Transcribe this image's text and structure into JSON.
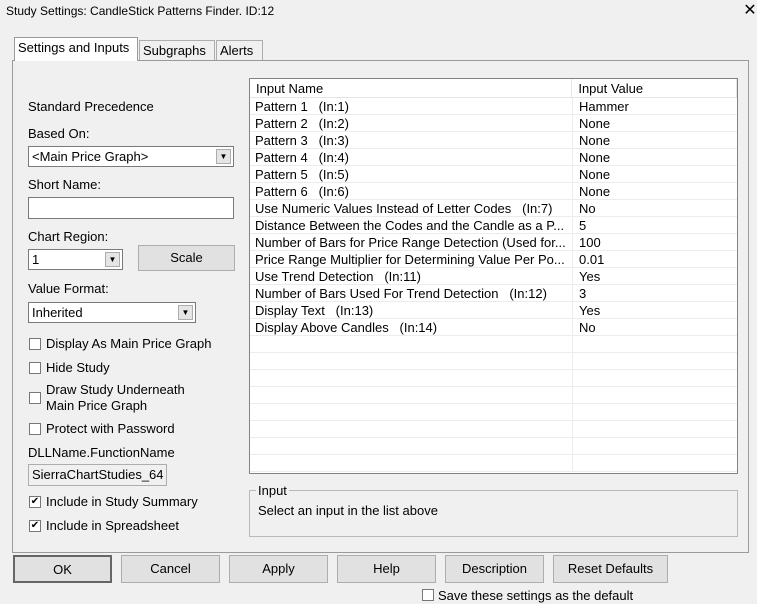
{
  "window": {
    "title": "Study Settings: CandleStick Patterns Finder. ID:12",
    "close": "✕"
  },
  "tabs": [
    "Settings and Inputs",
    "Subgraphs",
    "Alerts"
  ],
  "left": {
    "standard_precedence": "Standard Precedence",
    "based_on_label": "Based On:",
    "based_on_value": "<Main Price Graph>",
    "short_name_label": "Short Name:",
    "short_name_value": "",
    "chart_region_label": "Chart Region:",
    "chart_region_value": "1",
    "scale_button": "Scale",
    "value_format_label": "Value Format:",
    "value_format_value": "Inherited",
    "checkboxes": [
      {
        "label": "Display As Main Price Graph",
        "checked": false
      },
      {
        "label": "Hide Study",
        "checked": false
      },
      {
        "label": "Draw Study Underneath",
        "label2": "Main Price Graph",
        "checked": false
      },
      {
        "label": "Protect with Password",
        "checked": false
      }
    ],
    "dll_label": "DLLName.FunctionName",
    "dll_value": "SierraChartStudies_64",
    "include": [
      {
        "label": "Include in Study Summary",
        "checked": true
      },
      {
        "label": "Include in Spreadsheet",
        "checked": true
      }
    ]
  },
  "inputs": {
    "headers": [
      "Input Name",
      "Input Value"
    ],
    "rows": [
      [
        "Pattern 1   (In:1)",
        "Hammer"
      ],
      [
        "Pattern 2   (In:2)",
        "None"
      ],
      [
        "Pattern 3   (In:3)",
        "None"
      ],
      [
        "Pattern 4   (In:4)",
        "None"
      ],
      [
        "Pattern 5   (In:5)",
        "None"
      ],
      [
        "Pattern 6   (In:6)",
        "None"
      ],
      [
        "Use Numeric Values Instead of Letter Codes   (In:7)",
        "No"
      ],
      [
        "Distance Between the Codes and the Candle as a P...",
        "5"
      ],
      [
        "Number of Bars for Price Range Detection (Used for...",
        "100"
      ],
      [
        "Price Range Multiplier for Determining Value Per Po...",
        "0.01"
      ],
      [
        "Use Trend Detection   (In:11)",
        "Yes"
      ],
      [
        "Number of Bars Used For Trend Detection   (In:12)",
        "3"
      ],
      [
        "Display Text   (In:13)",
        "Yes"
      ],
      [
        "Display Above Candles   (In:14)",
        "No"
      ]
    ]
  },
  "input_group": {
    "label": "Input",
    "text": "Select an input in the list above"
  },
  "buttons": [
    "OK",
    "Cancel",
    "Apply",
    "Help",
    "Description",
    "Reset Defaults"
  ],
  "save_default": {
    "label": "Save these settings as the default",
    "checked": false
  }
}
